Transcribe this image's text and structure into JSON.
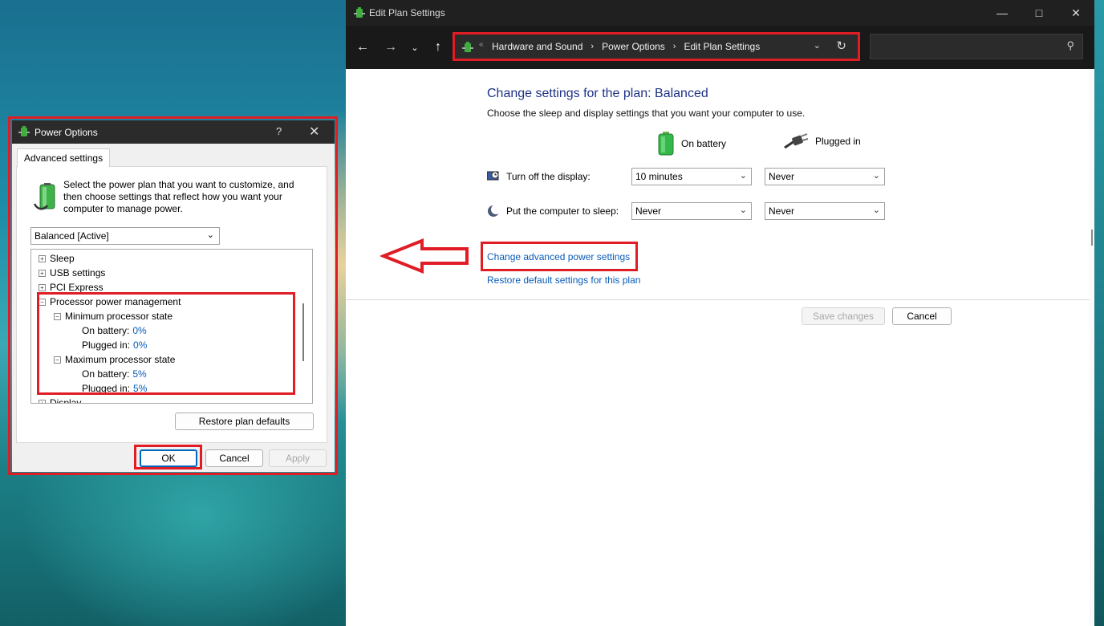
{
  "explorer": {
    "window_title": "Edit Plan Settings",
    "breadcrumbs": [
      "Hardware and Sound",
      "Power Options",
      "Edit Plan Settings"
    ],
    "search_placeholder": "",
    "heading": "Change settings for the plan: Balanced",
    "subheading": "Choose the sleep and display settings that you want your computer to use.",
    "col_battery": "On battery",
    "col_plugged": "Plugged in",
    "rows": [
      {
        "label": "Turn off the display:",
        "battery": "10 minutes",
        "plugged": "Never"
      },
      {
        "label": "Put the computer to sleep:",
        "battery": "Never",
        "plugged": "Never"
      }
    ],
    "link_advanced": "Change advanced power settings",
    "link_restore": "Restore default settings for this plan",
    "save_label": "Save changes",
    "cancel_label": "Cancel"
  },
  "dialog": {
    "title": "Power Options",
    "help": "?",
    "tab": "Advanced settings",
    "description": "Select the power plan that you want to customize, and then choose settings that reflect how you want your computer to manage power.",
    "plan": "Balanced [Active]",
    "tree": [
      {
        "label": "Sleep",
        "expander": "+"
      },
      {
        "label": "USB settings",
        "expander": "+"
      },
      {
        "label": "PCI Express",
        "expander": "+"
      },
      {
        "label": "Processor power management",
        "expander": "−"
      },
      {
        "label": "Minimum processor state",
        "expander": "−"
      },
      {
        "label": "On battery:",
        "value": "0%"
      },
      {
        "label": "Plugged in:",
        "value": "0%"
      },
      {
        "label": "Maximum processor state",
        "expander": "−"
      },
      {
        "label": "On battery:",
        "value": "5%"
      },
      {
        "label": "Plugged in:",
        "value": "5%"
      },
      {
        "label": "Display",
        "expander": "+"
      }
    ],
    "restore_label": "Restore plan defaults",
    "ok_label": "OK",
    "cancel_label": "Cancel",
    "apply_label": "Apply"
  },
  "colors": {
    "highlight": "#e01d25",
    "link": "#0a5cb8",
    "heading": "#1e3287",
    "titlebar": "#202020"
  }
}
